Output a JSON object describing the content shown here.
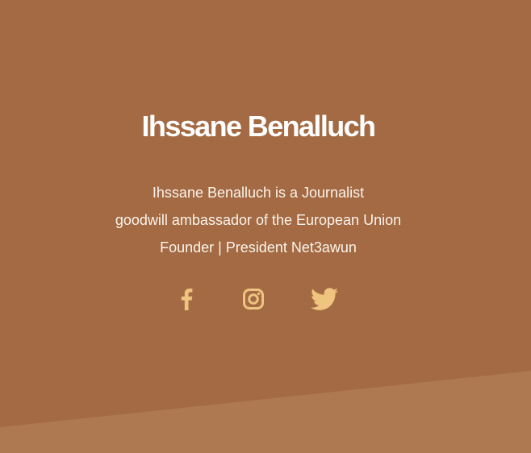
{
  "profile": {
    "name": "Ihssane Benalluch",
    "bio_lines": [
      "Ihssane Benalluch is a Journalist",
      "goodwill ambassador of the European Union",
      "Founder | President Net3awun"
    ]
  },
  "social": {
    "items": [
      {
        "icon": "facebook-icon"
      },
      {
        "icon": "instagram-icon"
      },
      {
        "icon": "twitter-icon"
      }
    ]
  },
  "colors": {
    "background": "#a36a43",
    "wedge": "#ae7851",
    "icon": "#eec47f",
    "title": "#ffffff",
    "text": "#fbf4ec"
  }
}
